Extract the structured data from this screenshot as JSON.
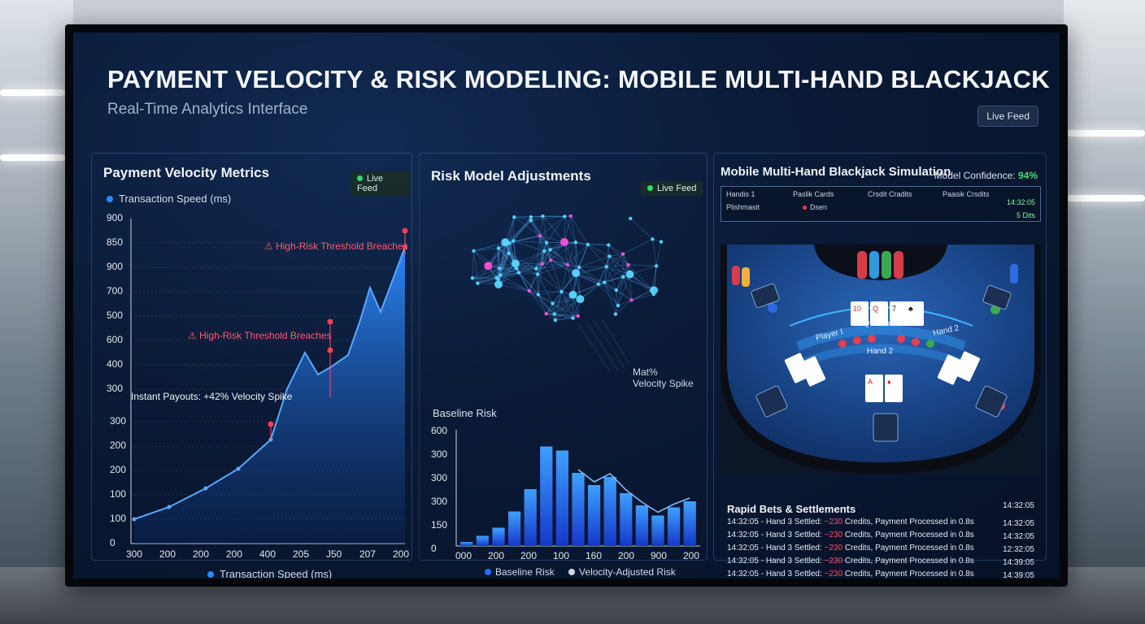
{
  "header": {
    "title": "PAYMENT VELOCITY & RISK MODELING: MOBILE MULTI-HAND BLACKJACK",
    "subtitle": "Real-Time Analytics Interface",
    "live_chip": "Live Feed"
  },
  "velocity_panel": {
    "title": "Payment Velocity Metrics",
    "feed_label": "Live Feed",
    "legend_top": "Transaction Speed (ms)",
    "legend_bottom": "Transaction Speed (ms)",
    "upper_y_ticks": [
      "900",
      "850",
      "900",
      "700",
      "500",
      "600",
      "400",
      "300"
    ],
    "lower_y_ticks": [
      "300",
      "200",
      "200",
      "100",
      "100",
      "0"
    ],
    "x_ticks": [
      "300",
      "200",
      "200",
      "200",
      "400",
      "205",
      "J50",
      "207",
      "200"
    ],
    "annotation_upper": "⚠ High-Risk Threshold Breaches",
    "annotation_lower": "⚠ High-Risk Threshold Breaches",
    "spike_note": "Instant Payouts: +42% Velocity Spike",
    "accent_color": "#2a8cff",
    "alert_color": "#ff5b6e"
  },
  "risk_panel": {
    "title": "Risk Model Adjustments",
    "feed_label": "Live Feed",
    "spike_label_line1": "Mat%",
    "spike_label_line2": "Velocity Spike",
    "baseline_label": "Baseline Risk",
    "y_ticks": [
      "600",
      "300",
      "300",
      "300",
      "150",
      "0"
    ],
    "x_ticks": [
      "000",
      "200",
      "200",
      "100",
      "160",
      "200",
      "900",
      "200"
    ],
    "legend_baseline": "Baseline Risk",
    "legend_adjusted": "Velocity-Adjusted Risk"
  },
  "chart_data": {
    "type": "bar",
    "categories": [
      "000",
      "",
      "",
      "200",
      "",
      "200",
      "100",
      "",
      "160",
      "",
      "200",
      "",
      "900",
      "",
      "200"
    ],
    "values": [
      10,
      25,
      45,
      85,
      140,
      245,
      235,
      180,
      150,
      170,
      130,
      100,
      75,
      95,
      110
    ],
    "ylim": [
      0,
      300
    ],
    "grid": true
  },
  "blackjack_panel": {
    "title": "Mobile Multi-Hand Blackjack Simulation",
    "confidence_label": "Model Confidence:",
    "confidence_value": "94%",
    "hud_row1": [
      "Handis 1",
      "Paslik Cards",
      "Crsdit Cradits",
      "Paasik Crsdits",
      "14:32:05"
    ],
    "hud_row2": [
      "Plishmasit",
      "Dsen",
      "5 Dits"
    ],
    "table_labels": {
      "player": "Player I",
      "hand1": "Hayer Hand 1",
      "hand2": "Hand 2",
      "hand2_side": "Hand 2"
    },
    "settlements_title": "Rapid Bets & Settlements",
    "settlement_log": [
      {
        "prefix": "14:32:05 - Hand 3 Settled: ",
        "amount": "~230",
        "suffix": " Credits, Payment Processed in 0.8s",
        "time": "14:32:05"
      },
      {
        "prefix": "14:32:05 - Hand 3 Settled: ",
        "amount": "~230",
        "suffix": " Credits, Payment Processed in 0.8s",
        "time": "14:32:05"
      },
      {
        "prefix": "14:32:05 - Hand 3 Settled: ",
        "amount": "~230",
        "suffix": " Credits, Payment Processed in 0.8s",
        "time": "12:32:05"
      },
      {
        "prefix": "14:32:05 - Hand 3 Settled: ",
        "amount": "~230",
        "suffix": " Credits, Payment Processed in 0.8s",
        "time": "14:39:05"
      },
      {
        "prefix": "14:32:05 - Hand 3 Settled: ",
        "amount": "~230",
        "suffix": " Credits, Payment Processed in 0.8s",
        "time": "14:39:05"
      }
    ],
    "log_header_time": "14:32:05"
  }
}
